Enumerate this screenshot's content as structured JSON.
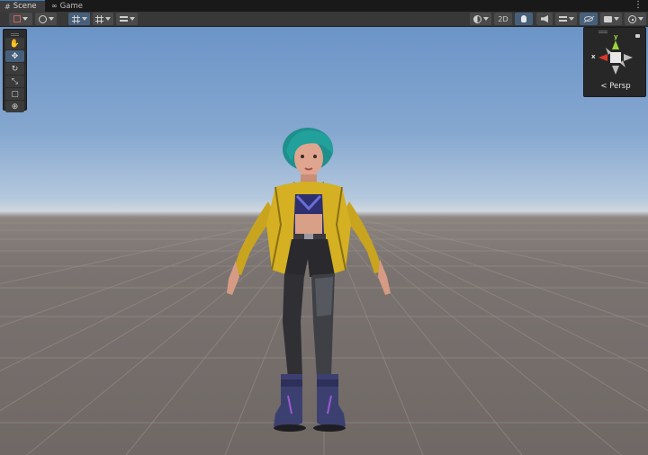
{
  "tabs": [
    {
      "label": "Scene",
      "icon": "hash-icon",
      "active": true
    },
    {
      "label": "Game",
      "icon": "gamepad-icon",
      "active": false
    }
  ],
  "toolbar": {
    "mode_2d_label": "2D",
    "accent_color": "#46607c"
  },
  "tools": [
    "hand-tool",
    "move-tool",
    "rotate-tool",
    "scale-tool",
    "rect-tool",
    "transform-tool"
  ],
  "orientation": {
    "y_label": "y",
    "x_label": "x",
    "projection_label": "< Persp"
  },
  "colors": {
    "sky_top": "#6b94c7",
    "horizon": "#cfd7df",
    "ground": "#7a7370",
    "axis_x": "#d83a2a",
    "axis_y": "#9bd33a"
  }
}
